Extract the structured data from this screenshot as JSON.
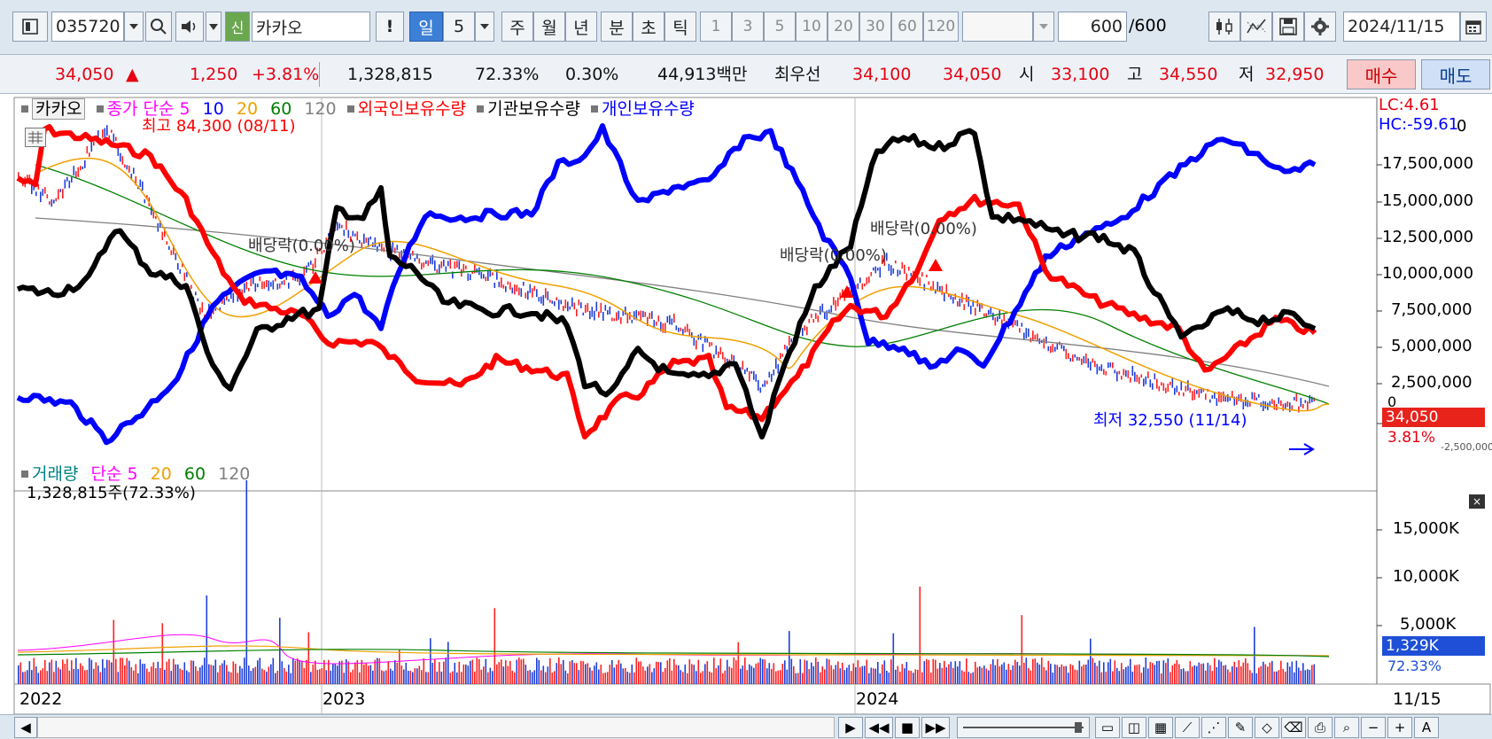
{
  "toolbar": {
    "code": "035720",
    "badge_new": "신",
    "stock_name": "카카오",
    "warn": "!",
    "period_day": "일",
    "period_n": "5",
    "period_week": "주",
    "period_month": "월",
    "period_year": "년",
    "period_min": "분",
    "period_sec": "초",
    "period_tick": "틱",
    "intervals": [
      "1",
      "3",
      "5",
      "10",
      "20",
      "30",
      "60",
      "120"
    ],
    "count_value": "600",
    "count_total": "/600",
    "date": "2024/11/15"
  },
  "info": {
    "price": "34,050",
    "up_arrow": "▲",
    "change": "1,250",
    "change_pct": "+3.81%",
    "volume": "1,328,815",
    "volume_pct": "72.33%",
    "turnover_pct": "0.30%",
    "amount": "44,913백만",
    "best_label": "최우선",
    "best_ask": "34,100",
    "best_bid": "34,050",
    "open_label": "시",
    "open": "33,100",
    "high_label": "고",
    "high": "34,550",
    "low_label": "저",
    "low": "32,950",
    "buy_label": "매수",
    "sell_label": "매도"
  },
  "legend_top": {
    "name": "카카오",
    "close_simple": "종가 단순",
    "ma5": "5",
    "ma10": "10",
    "ma20": "20",
    "ma60": "60",
    "ma120": "120",
    "foreign": "외국인보유수량",
    "inst": "기관보유수량",
    "individual": "개인보유수량",
    "lc": "LC:4.61",
    "hc": "HC:-59.61"
  },
  "annotations": {
    "high_note": "최고 84,300 (08/11)",
    "low_note": "최저 32,550 (11/14)",
    "div1": "배당락(0.00%)",
    "div2": "배당락(0.00%)",
    "div3": "배당락(0.00%)"
  },
  "right_axis": {
    "ticks": [
      "17,500,000",
      "15,000,000",
      "12,500,000",
      "10,000,000",
      "7,500,000",
      "5,000,000",
      "2,500,000"
    ],
    "top_partial": "0",
    "zero": "0",
    "bottom_partial": "-2,500,000",
    "price_box": "34,050",
    "pct_box": "3.81%"
  },
  "volume_legend": {
    "name": "거래량",
    "simple": "단순",
    "ma5": "5",
    "ma20": "20",
    "ma60": "60",
    "ma120": "120",
    "value": "1,328,815주(72.33%)",
    "ticks": [
      "15,000K",
      "10,000K",
      "5,000K"
    ],
    "box_value": "1,329K",
    "box_pct": "72.33%"
  },
  "x_axis": {
    "labels": [
      "2022",
      "2023",
      "2024"
    ],
    "last": "11/15"
  },
  "colors": {
    "foreign": "#ff0000",
    "institution": "#000000",
    "individual": "#0000ff",
    "ma5": "#ff00ff",
    "ma10": "#0000ff",
    "ma20": "#f0a000",
    "ma60": "#008000",
    "ma120": "#808080"
  },
  "chart_data": {
    "type": "line",
    "x": [
      "2022",
      "2023",
      "2024",
      "11/15"
    ],
    "series": [
      {
        "name": "외국인보유수량",
        "values": [
          21000000,
          5500000,
          1000000,
          8000000,
          15500000,
          5500000
        ]
      },
      {
        "name": "기관보유수량",
        "values": [
          8000000,
          12000000,
          17500000,
          -2000000,
          20000000,
          5000000
        ]
      },
      {
        "name": "개인보유수량",
        "values": [
          1000000,
          -2000000,
          21000000,
          18000000,
          3000000,
          17500000
        ]
      }
    ]
  }
}
